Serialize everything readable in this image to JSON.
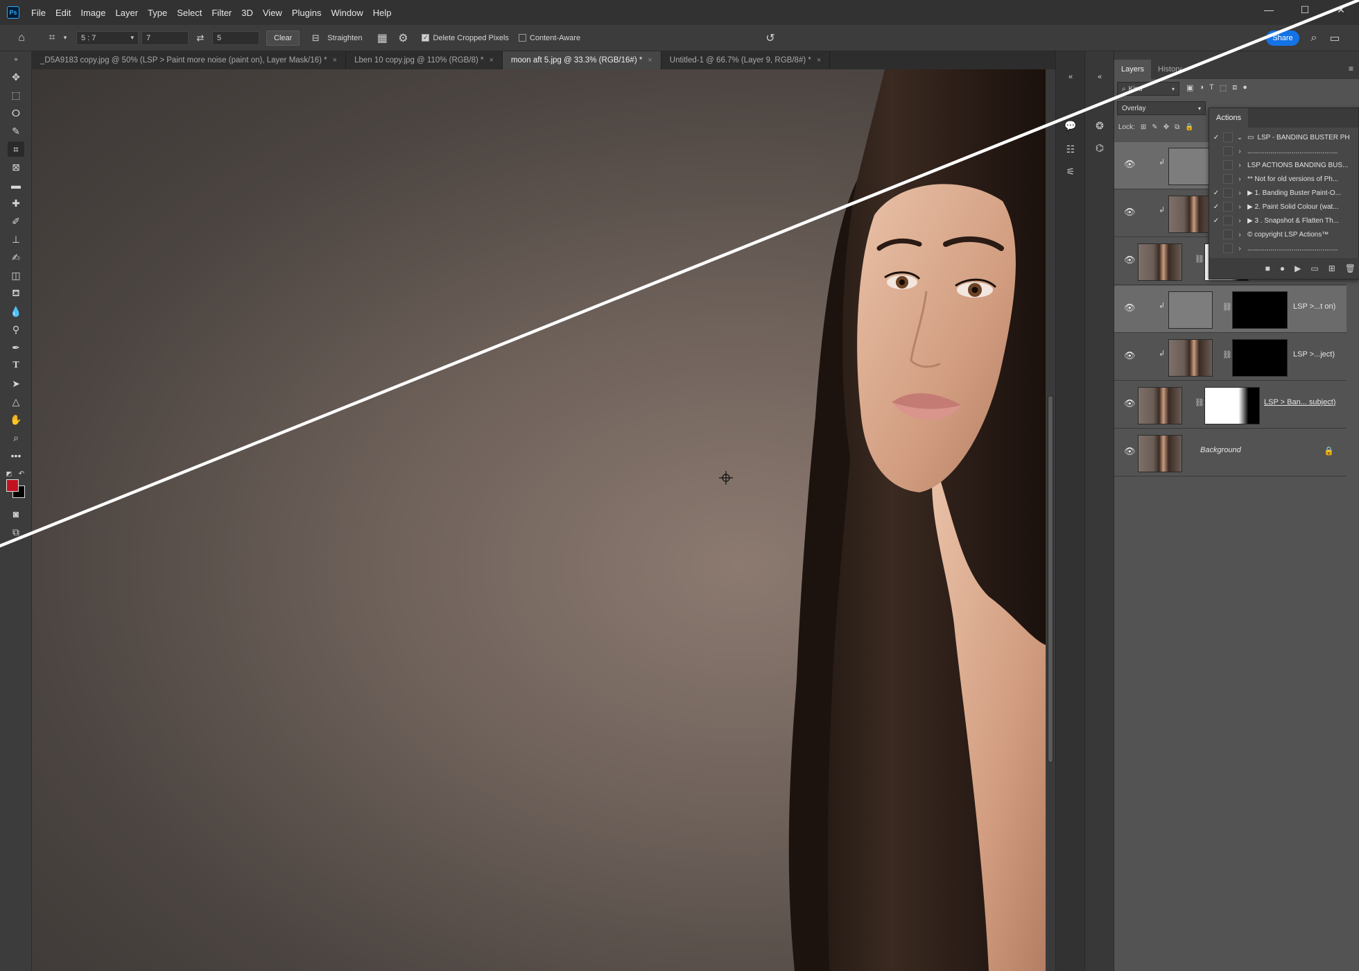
{
  "menubar": {
    "logo": "Ps",
    "items": [
      "File",
      "Edit",
      "Image",
      "Layer",
      "Type",
      "Select",
      "Filter",
      "3D",
      "View",
      "Plugins",
      "Window",
      "Help"
    ],
    "window_controls": [
      "—",
      "☐",
      "✕"
    ]
  },
  "options": {
    "ratio": "5 : 7",
    "width": "7",
    "height": "5",
    "clear_label": "Clear",
    "straighten_label": "Straighten",
    "delete_cropped_label": "Delete Cropped Pixels",
    "delete_cropped_checked": true,
    "content_aware_label": "Content-Aware",
    "content_aware_checked": false,
    "share_label": "Share"
  },
  "tabs": [
    {
      "label": "_D5A9183 copy.jpg @ 50% (LSP > Paint more noise (paint on), Layer Mask/16) *",
      "active": false
    },
    {
      "label": "Lben 10 copy.jpg @ 110% (RGB/8) *",
      "active": false
    },
    {
      "label": "moon aft 5.jpg @ 33.3% (RGB/16#) *",
      "active": true
    },
    {
      "label": "Untitled-1 @ 66.7% (Layer 9, RGB/8#) *",
      "active": false
    }
  ],
  "layers_panel": {
    "tabs": [
      "Layers",
      "History"
    ],
    "kind_filter": "Kind",
    "blend_mode": "Overlay",
    "lock_label": "Lock:",
    "layers": [
      {
        "name": "",
        "selected": true
      },
      {
        "name": "",
        "selected": false
      },
      {
        "name": "",
        "selected": false
      },
      {
        "name": "LSP >...t on)",
        "selected": true
      },
      {
        "name": "LSP >...ject)",
        "selected": false
      },
      {
        "name": "LSP > Ban... subject)",
        "selected": false
      },
      {
        "name": "Background",
        "selected": false
      }
    ]
  },
  "actions_panel": {
    "title": "Actions",
    "items": [
      {
        "label": "LSP - BANDING BUSTER PH",
        "checked": true
      },
      {
        "label": "...............................................",
        "checked": false
      },
      {
        "label": "LSP ACTIONS BANDING BUS...",
        "checked": false
      },
      {
        "label": "** Not for old versions of Ph...",
        "checked": false
      },
      {
        "label": "▶ 1. Banding Buster Paint-O...",
        "checked": true
      },
      {
        "label": "▶ 2. Paint Solid Colour (wat...",
        "checked": true
      },
      {
        "label": "▶ 3 . Snapshot & Flatten Th...",
        "checked": true
      },
      {
        "label": "© copyright LSP Actions™",
        "checked": false
      },
      {
        "label": "...............................................",
        "checked": false
      }
    ]
  },
  "colors": {
    "foreground": "#c1121f",
    "background": "#000000",
    "accent": "#1473e6"
  }
}
